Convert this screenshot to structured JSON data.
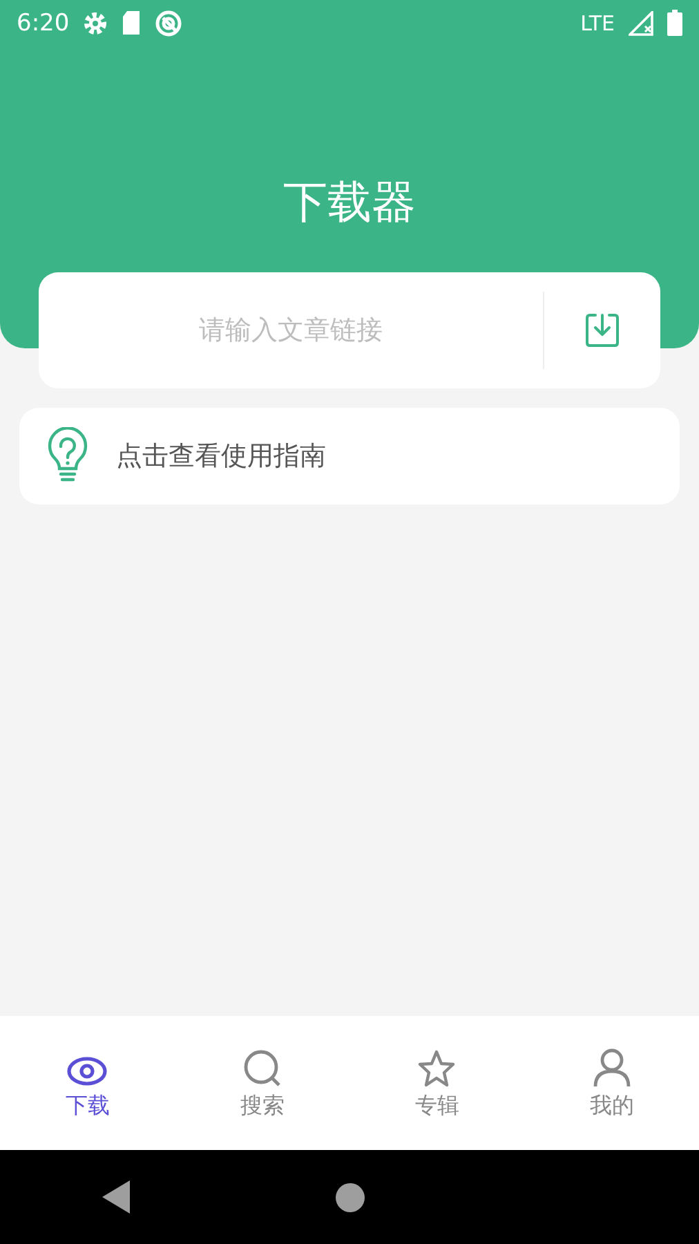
{
  "status_bar": {
    "time": "6:20",
    "network": "LTE"
  },
  "title": "下载器",
  "link_input": {
    "placeholder": "请输入文章链接"
  },
  "guide": {
    "label": "点击查看使用指南"
  },
  "tabs": [
    {
      "label": "下载",
      "selected": true
    },
    {
      "label": "搜索",
      "selected": false
    },
    {
      "label": "专辑",
      "selected": false
    },
    {
      "label": "我的",
      "selected": false
    }
  ]
}
